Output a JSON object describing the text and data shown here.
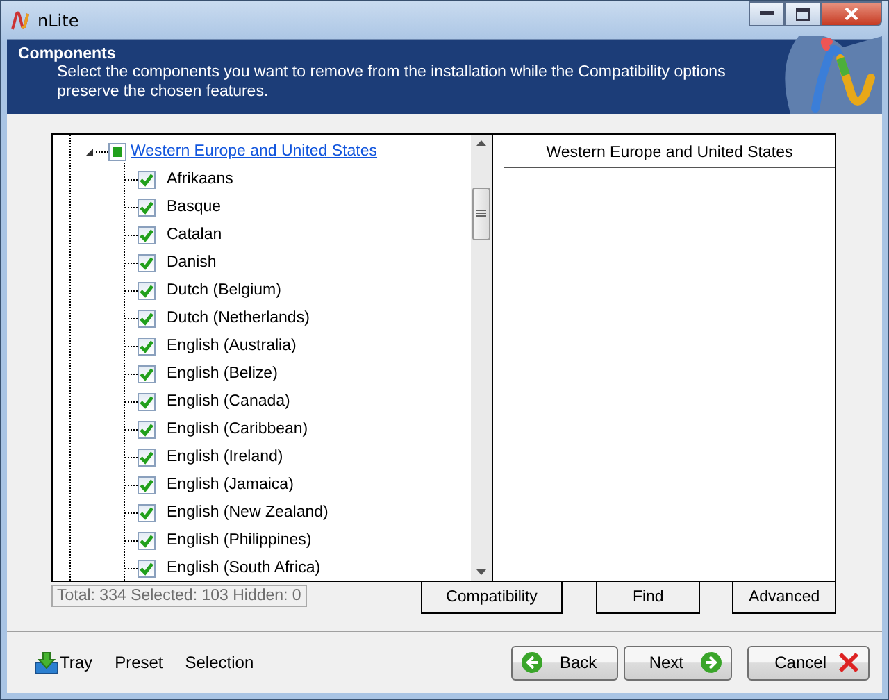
{
  "window": {
    "title": "nLite"
  },
  "header": {
    "title": "Components",
    "description": "Select the components you want to remove from the installation while the Compatibility options preserve the chosen features."
  },
  "tree": {
    "group": {
      "label": "Western Europe and United States",
      "expanded": true,
      "mixed": true,
      "children": [
        {
          "label": "Afrikaans",
          "checked": true
        },
        {
          "label": "Basque",
          "checked": true
        },
        {
          "label": "Catalan",
          "checked": true
        },
        {
          "label": "Danish",
          "checked": true
        },
        {
          "label": "Dutch (Belgium)",
          "checked": true
        },
        {
          "label": "Dutch (Netherlands)",
          "checked": true
        },
        {
          "label": "English (Australia)",
          "checked": true
        },
        {
          "label": "English (Belize)",
          "checked": true
        },
        {
          "label": "English (Canada)",
          "checked": true
        },
        {
          "label": "English (Caribbean)",
          "checked": true
        },
        {
          "label": "English (Ireland)",
          "checked": true
        },
        {
          "label": "English (Jamaica)",
          "checked": true
        },
        {
          "label": "English (New Zealand)",
          "checked": true
        },
        {
          "label": "English (Philippines)",
          "checked": true
        },
        {
          "label": "English (South Africa)",
          "checked": true
        }
      ]
    }
  },
  "details": {
    "title": "Western Europe and United States"
  },
  "status": "Total: 334 Selected: 103 Hidden: 0",
  "panel_buttons": [
    "Compatibility",
    "Find",
    "Advanced"
  ],
  "footer_links": [
    {
      "label": "Tray",
      "kind": "icon"
    },
    {
      "label": "Preset",
      "kind": "text"
    },
    {
      "label": "Selection",
      "kind": "text"
    }
  ],
  "nav_buttons": [
    {
      "label": "Back",
      "kind": "back"
    },
    {
      "label": "Next",
      "kind": "next"
    },
    {
      "label": "Cancel",
      "kind": "cancel"
    }
  ]
}
